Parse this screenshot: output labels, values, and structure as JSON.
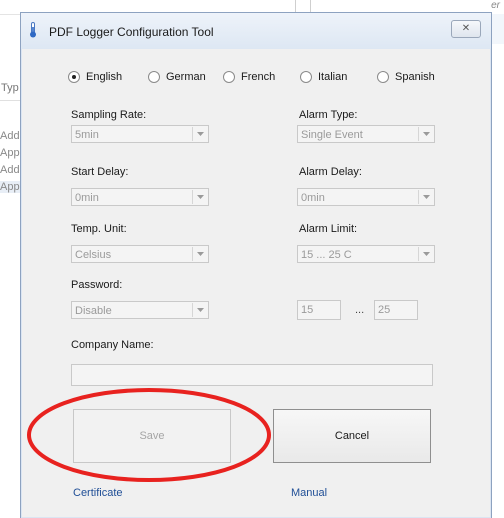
{
  "background": {
    "tab_right_text": "er",
    "left_column": [
      "Typ",
      "Add",
      "App",
      "Add",
      "App"
    ]
  },
  "dialog": {
    "title": "PDF Logger Configuration Tool",
    "close_label": "✕",
    "languages": [
      {
        "label": "English",
        "selected": true
      },
      {
        "label": "German",
        "selected": false
      },
      {
        "label": "French",
        "selected": false
      },
      {
        "label": "Italian",
        "selected": false
      },
      {
        "label": "Spanish",
        "selected": false
      }
    ],
    "fields": {
      "sampling_rate": {
        "label": "Sampling Rate:",
        "value": "5min"
      },
      "alarm_type": {
        "label": "Alarm Type:",
        "value": "Single Event"
      },
      "start_delay": {
        "label": "Start Delay:",
        "value": "0min"
      },
      "alarm_delay": {
        "label": "Alarm Delay:",
        "value": "0min"
      },
      "temp_unit": {
        "label": "Temp. Unit:",
        "value": "Celsius"
      },
      "alarm_limit": {
        "label": "Alarm Limit:",
        "value": "15 ... 25 C"
      },
      "password": {
        "label": "Password:",
        "value": "Disable"
      },
      "limit_low": "15",
      "limit_high": "25",
      "range_separator": "...",
      "company_name": {
        "label": "Company Name:",
        "value": ""
      }
    },
    "buttons": {
      "save": "Save",
      "cancel": "Cancel"
    },
    "links": {
      "certificate": "Certificate",
      "manual": "Manual"
    }
  },
  "colors": {
    "annotation_ellipse": "#e8221f",
    "link": "#1f4e96",
    "disabled_text": "#a5a5a5"
  }
}
